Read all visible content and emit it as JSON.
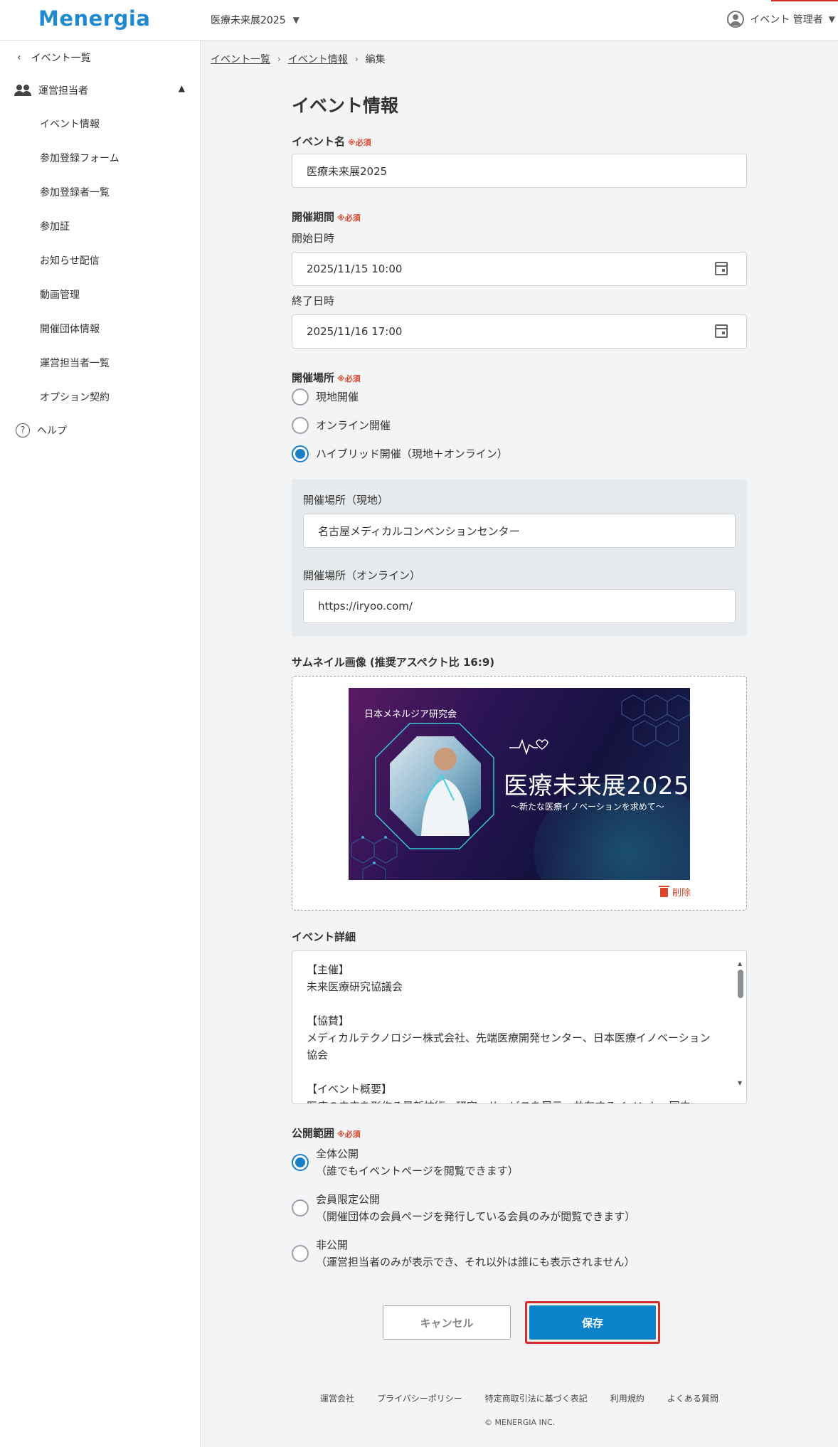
{
  "header": {
    "logo": "Menergia",
    "event_selector": "医療未来展2025",
    "user": "イベント 管理者"
  },
  "sidebar": {
    "back_label": "イベント一覧",
    "group_label": "運営担当者",
    "items": [
      "イベント情報",
      "参加登録フォーム",
      "参加登録者一覧",
      "参加証",
      "お知らせ配信",
      "動画管理",
      "開催団体情報",
      "運営担当者一覧",
      "オプション契約"
    ],
    "help_label": "ヘルプ"
  },
  "breadcrumb": {
    "items": [
      "イベント一覧",
      "イベント情報",
      "編集"
    ]
  },
  "form": {
    "title": "イベント情報",
    "required_mark": "※必須",
    "event_name_label": "イベント名",
    "event_name_value": "医療未来展2025",
    "period_label": "開催期間",
    "start_label": "開始日時",
    "start_value": "2025/11/15 10:00",
    "end_label": "終了日時",
    "end_value": "2025/11/16 17:00",
    "venue_label": "開催場所",
    "venue_options": [
      "現地開催",
      "オンライン開催",
      "ハイブリッド開催（現地＋オンライン）"
    ],
    "venue_selected": 2,
    "venue_onsite_label": "開催場所（現地）",
    "venue_onsite_value": "名古屋メディカルコンベンションセンター",
    "venue_online_label": "開催場所（オンライン）",
    "venue_online_value": "https://iryoo.com/",
    "thumbnail_label": "サムネイル画像 (推奨アスペクト比 16:9)",
    "thumbnail": {
      "org": "日本メネルジア研究会",
      "title": "医療未来展2025",
      "subtitle": "〜新たな医療イノベーションを求めて〜"
    },
    "delete_label": "削除",
    "details_label": "イベント詳細",
    "details_text": "【主催】\n未来医療研究協議会\n\n【協賛】\nメディカルテクノロジー株式会社、先端医療開発センター、日本医療イノベーション協会\n\n【イベント概要】\n医療の未来を形作る最新技術、研究、サービスを展示・共有するイベント。国内",
    "visibility_label": "公開範囲",
    "visibility_options": [
      {
        "title": "全体公開",
        "desc": "（誰でもイベントページを閲覧できます）"
      },
      {
        "title": "会員限定公開",
        "desc": "（開催団体の会員ページを発行している会員のみが閲覧できます）"
      },
      {
        "title": "非公開",
        "desc": "（運営担当者のみが表示でき、それ以外は誰にも表示されません）"
      }
    ],
    "visibility_selected": 0,
    "cancel_label": "キャンセル",
    "save_label": "保存"
  },
  "footer": {
    "links": [
      "運営会社",
      "プライバシーポリシー",
      "特定商取引法に基づく表記",
      "利用規約",
      "よくある質問"
    ],
    "copyright": "© MENERGIA INC."
  },
  "colors": {
    "brand": "#1f8ad0",
    "primary_button": "#0b82c9",
    "required": "#d9462b",
    "highlight_border": "#d42b2b"
  }
}
